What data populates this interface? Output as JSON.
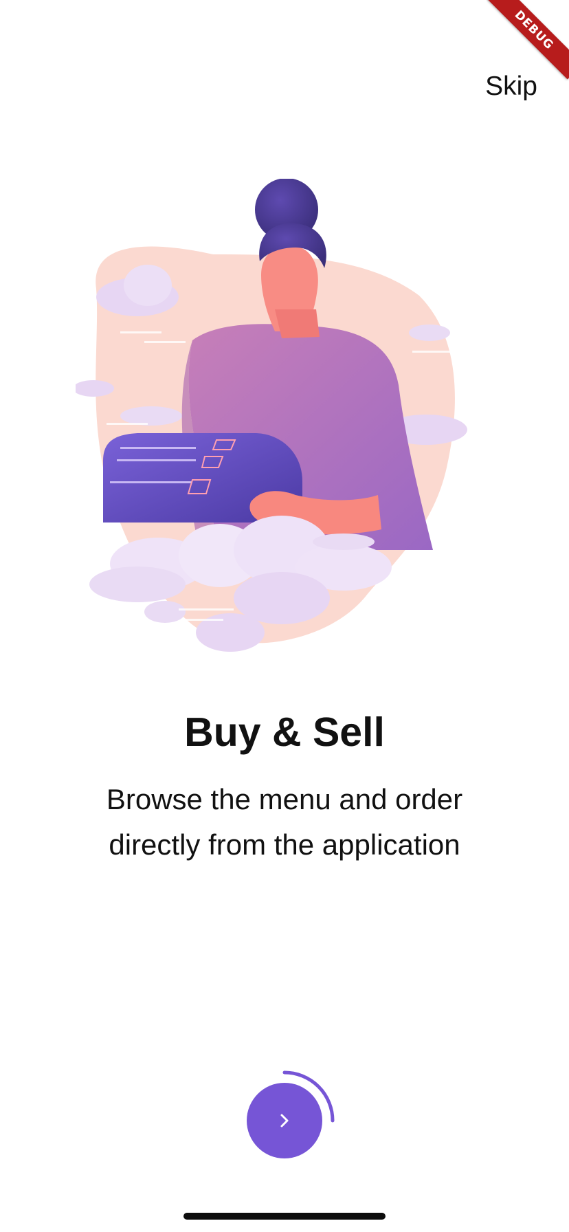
{
  "debug_banner": {
    "text": "DEBUG"
  },
  "header": {
    "skip_label": "Skip"
  },
  "onboarding": {
    "title": "Buy & Sell",
    "subtitle": "Browse the menu and order directly from the application"
  },
  "progress": {
    "fraction": 0.25
  },
  "icons": {
    "next": "chevron-right-icon"
  },
  "colors": {
    "accent": "#7655d6",
    "background": "#ffffff",
    "text": "#111111",
    "debug_banner": "#b71c1c"
  }
}
